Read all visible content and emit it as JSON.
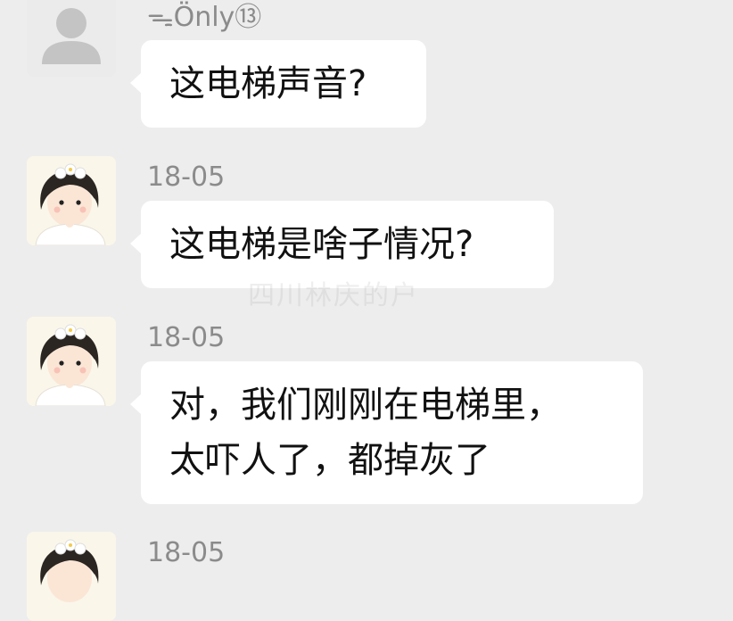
{
  "messages": [
    {
      "sender": "ᯓÖnly⑬",
      "avatar": "default-avatar",
      "text": "这电梯声音?"
    },
    {
      "sender": "18-05",
      "avatar": "girl-avatar",
      "text": "这电梯是啥子情况?"
    },
    {
      "sender": "18-05",
      "avatar": "girl-avatar",
      "text": "对，我们刚刚在电梯里，\n太吓人了，都掉灰了"
    },
    {
      "sender": "18-05",
      "avatar": "girl-avatar",
      "text": ""
    }
  ],
  "watermark": "四川林庆的户"
}
